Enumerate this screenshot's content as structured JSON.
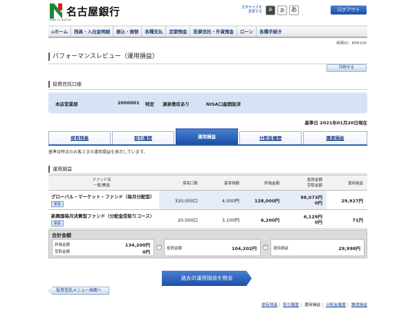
{
  "header": {
    "bank_name": "名古屋銀行",
    "bank_sub": "BANK OF NAGOYA",
    "font_size_label": "文字サイズを変更する",
    "font_sizes": [
      "あ",
      "あ",
      "あ"
    ],
    "logout_label": "ログアウト"
  },
  "nav": {
    "items": [
      "ホーム",
      "残高・入出金明細",
      "振込・振替",
      "各種支払",
      "定期預金",
      "投資信託・外貨預金",
      "ローン",
      "各種手続き"
    ]
  },
  "screen_id": "画面ID：BPR106",
  "page_title": "パフォーマンスレビュー（運用損益）",
  "print_label": "印刷する",
  "account_section": {
    "title": "投資信託口座",
    "branch": "本店営業部",
    "account_no": "2000001",
    "type": "特定",
    "withholding": "源泉徴収あり",
    "nisa": "NISA口座開設済"
  },
  "base_date": "基準日 2021年01月20日現在",
  "tabs": [
    "保有残高",
    "取引履歴",
    "運用損益",
    "分配金履歴",
    "譲渡損益"
  ],
  "description": "基準日時点のお客さまの運用損益を表示しています。",
  "pl_section": {
    "title": "運用損益",
    "headers": {
      "fund": "ファンド名",
      "fund_sub": "一般/累投",
      "units": "保有口数",
      "nav": "基準価額",
      "valuation": "評価金額",
      "paid": "投資金額",
      "paid_sub": "受取金額",
      "pl": "運用損益"
    },
    "rows": [
      {
        "name": "グローバル・マーケット・ファンド（毎月分配型）",
        "badge": "累投",
        "units": "320,000口",
        "nav": "4,000円",
        "valuation": "128,000円",
        "invest": "98,073円",
        "receive": "0円",
        "pl": "29,927円"
      },
      {
        "name": "新興国毎月決算型ファンド（分配金受取りコース）",
        "badge": "累投",
        "units": "20,000口",
        "nav": "3,100円",
        "valuation": "6,200円",
        "invest": "6,129円",
        "receive": "0円",
        "pl": "71円"
      }
    ]
  },
  "total": {
    "title": "合計金額",
    "valuation_label": "評価金額",
    "receive_label": "受取金額",
    "valuation": "134,200円",
    "receive": "0円",
    "minus": "－",
    "invest_label": "投資金額",
    "invest": "104,202円",
    "equals": "＝",
    "pl_label": "運用損益",
    "pl": "29,998円"
  },
  "history_button": "過去の運用損益を照会",
  "menu_button": "投資信託メニュー画面へ",
  "footer_links": [
    "保有残高",
    "取引履歴",
    "運用損益",
    "分配金履歴",
    "譲渡損益"
  ],
  "colors": {
    "accent": "#1c50a8",
    "logo_green": "#1a8a3a",
    "logo_red": "#d22020"
  }
}
